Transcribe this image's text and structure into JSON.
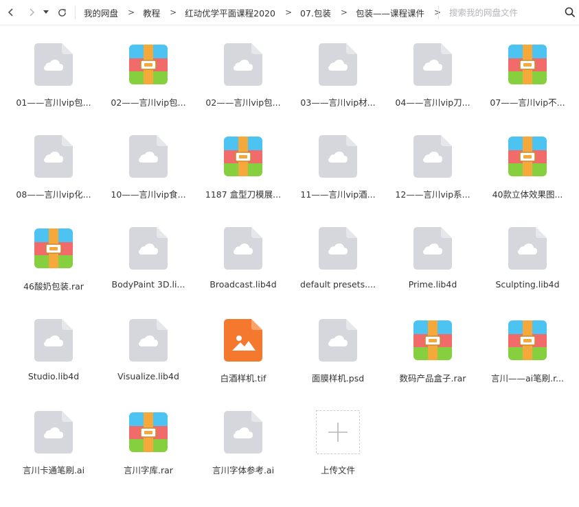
{
  "nav": {
    "back_icon": "chevron-left-icon",
    "forward_icon": "chevron-right-icon",
    "history_icon": "caret-down-icon",
    "refresh_icon": "refresh-icon"
  },
  "breadcrumb": [
    "我的网盘",
    "教程",
    "红动优学平面课程2020",
    "07.包装",
    "包装——课程课件"
  ],
  "breadcrumb_separator": ">",
  "search": {
    "placeholder": "搜索我的网盘文件",
    "value": ""
  },
  "colors": {
    "cloud_file": "#d5d7dc",
    "image_file": "#f4792f",
    "archive_blue": "#4cc3f0",
    "archive_red": "#f16b6b",
    "archive_green": "#86cf3f",
    "archive_belt": "#f4a93a"
  },
  "files": [
    {
      "name": "01——言川vip包...",
      "type": "cloud"
    },
    {
      "name": "02——言川vip包...",
      "type": "archive"
    },
    {
      "name": "02——言川vip包...",
      "type": "cloud"
    },
    {
      "name": "03——言川vip材...",
      "type": "cloud"
    },
    {
      "name": "04——言川vip刀...",
      "type": "cloud"
    },
    {
      "name": "07——言川vip不...",
      "type": "archive"
    },
    {
      "name": "08——言川vip化...",
      "type": "cloud"
    },
    {
      "name": "10——言川vip食...",
      "type": "cloud"
    },
    {
      "name": "1187 盒型刀模展...",
      "type": "archive"
    },
    {
      "name": "11——言川vip酒...",
      "type": "cloud"
    },
    {
      "name": "12——言川vip系...",
      "type": "cloud"
    },
    {
      "name": "40款立体效果图...",
      "type": "archive"
    },
    {
      "name": "46酸奶包装.rar",
      "type": "archive"
    },
    {
      "name": "BodyPaint 3D.li...",
      "type": "cloud"
    },
    {
      "name": "Broadcast.lib4d",
      "type": "cloud"
    },
    {
      "name": "default presets....",
      "type": "cloud"
    },
    {
      "name": "Prime.lib4d",
      "type": "cloud"
    },
    {
      "name": "Sculpting.lib4d",
      "type": "cloud"
    },
    {
      "name": "Studio.lib4d",
      "type": "cloud"
    },
    {
      "name": "Visualize.lib4d",
      "type": "cloud"
    },
    {
      "name": "白酒样机.tif",
      "type": "image"
    },
    {
      "name": "面膜样机.psd",
      "type": "cloud"
    },
    {
      "name": "数码产品盒子.rar",
      "type": "archive"
    },
    {
      "name": "言川——ai笔刷.r...",
      "type": "archive"
    },
    {
      "name": "言川卡通笔刷.ai",
      "type": "cloud"
    },
    {
      "name": "言川字库.rar",
      "type": "archive"
    },
    {
      "name": "言川字体参考.ai",
      "type": "cloud"
    },
    {
      "name": "上传文件",
      "type": "upload"
    }
  ]
}
